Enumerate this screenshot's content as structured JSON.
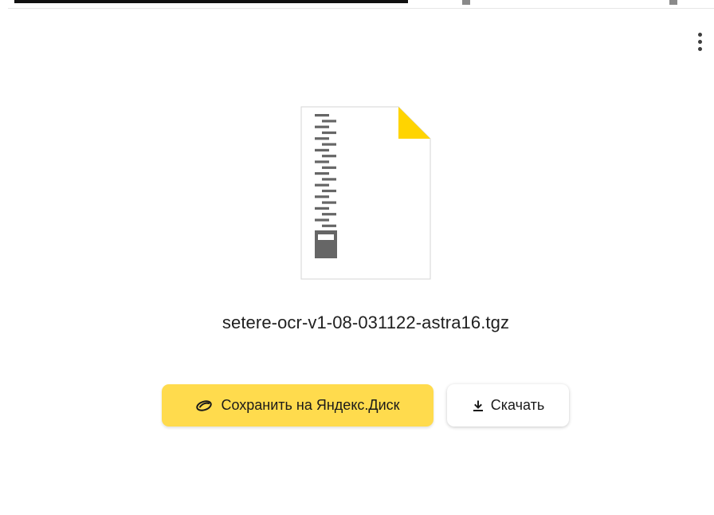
{
  "file": {
    "name": "setere-ocr-v1-08-031122-astra16.tgz",
    "icon": "archive-file-icon"
  },
  "actions": {
    "save_label": "Сохранить на Яндекс.Диск",
    "save_icon": "yandex-disk-icon",
    "download_label": "Скачать",
    "download_icon": "download-icon"
  },
  "menu": {
    "icon": "more-vertical-icon"
  },
  "colors": {
    "primary_button": "#ffdb4d",
    "file_corner": "#ffd400",
    "zipper": "#666666"
  }
}
